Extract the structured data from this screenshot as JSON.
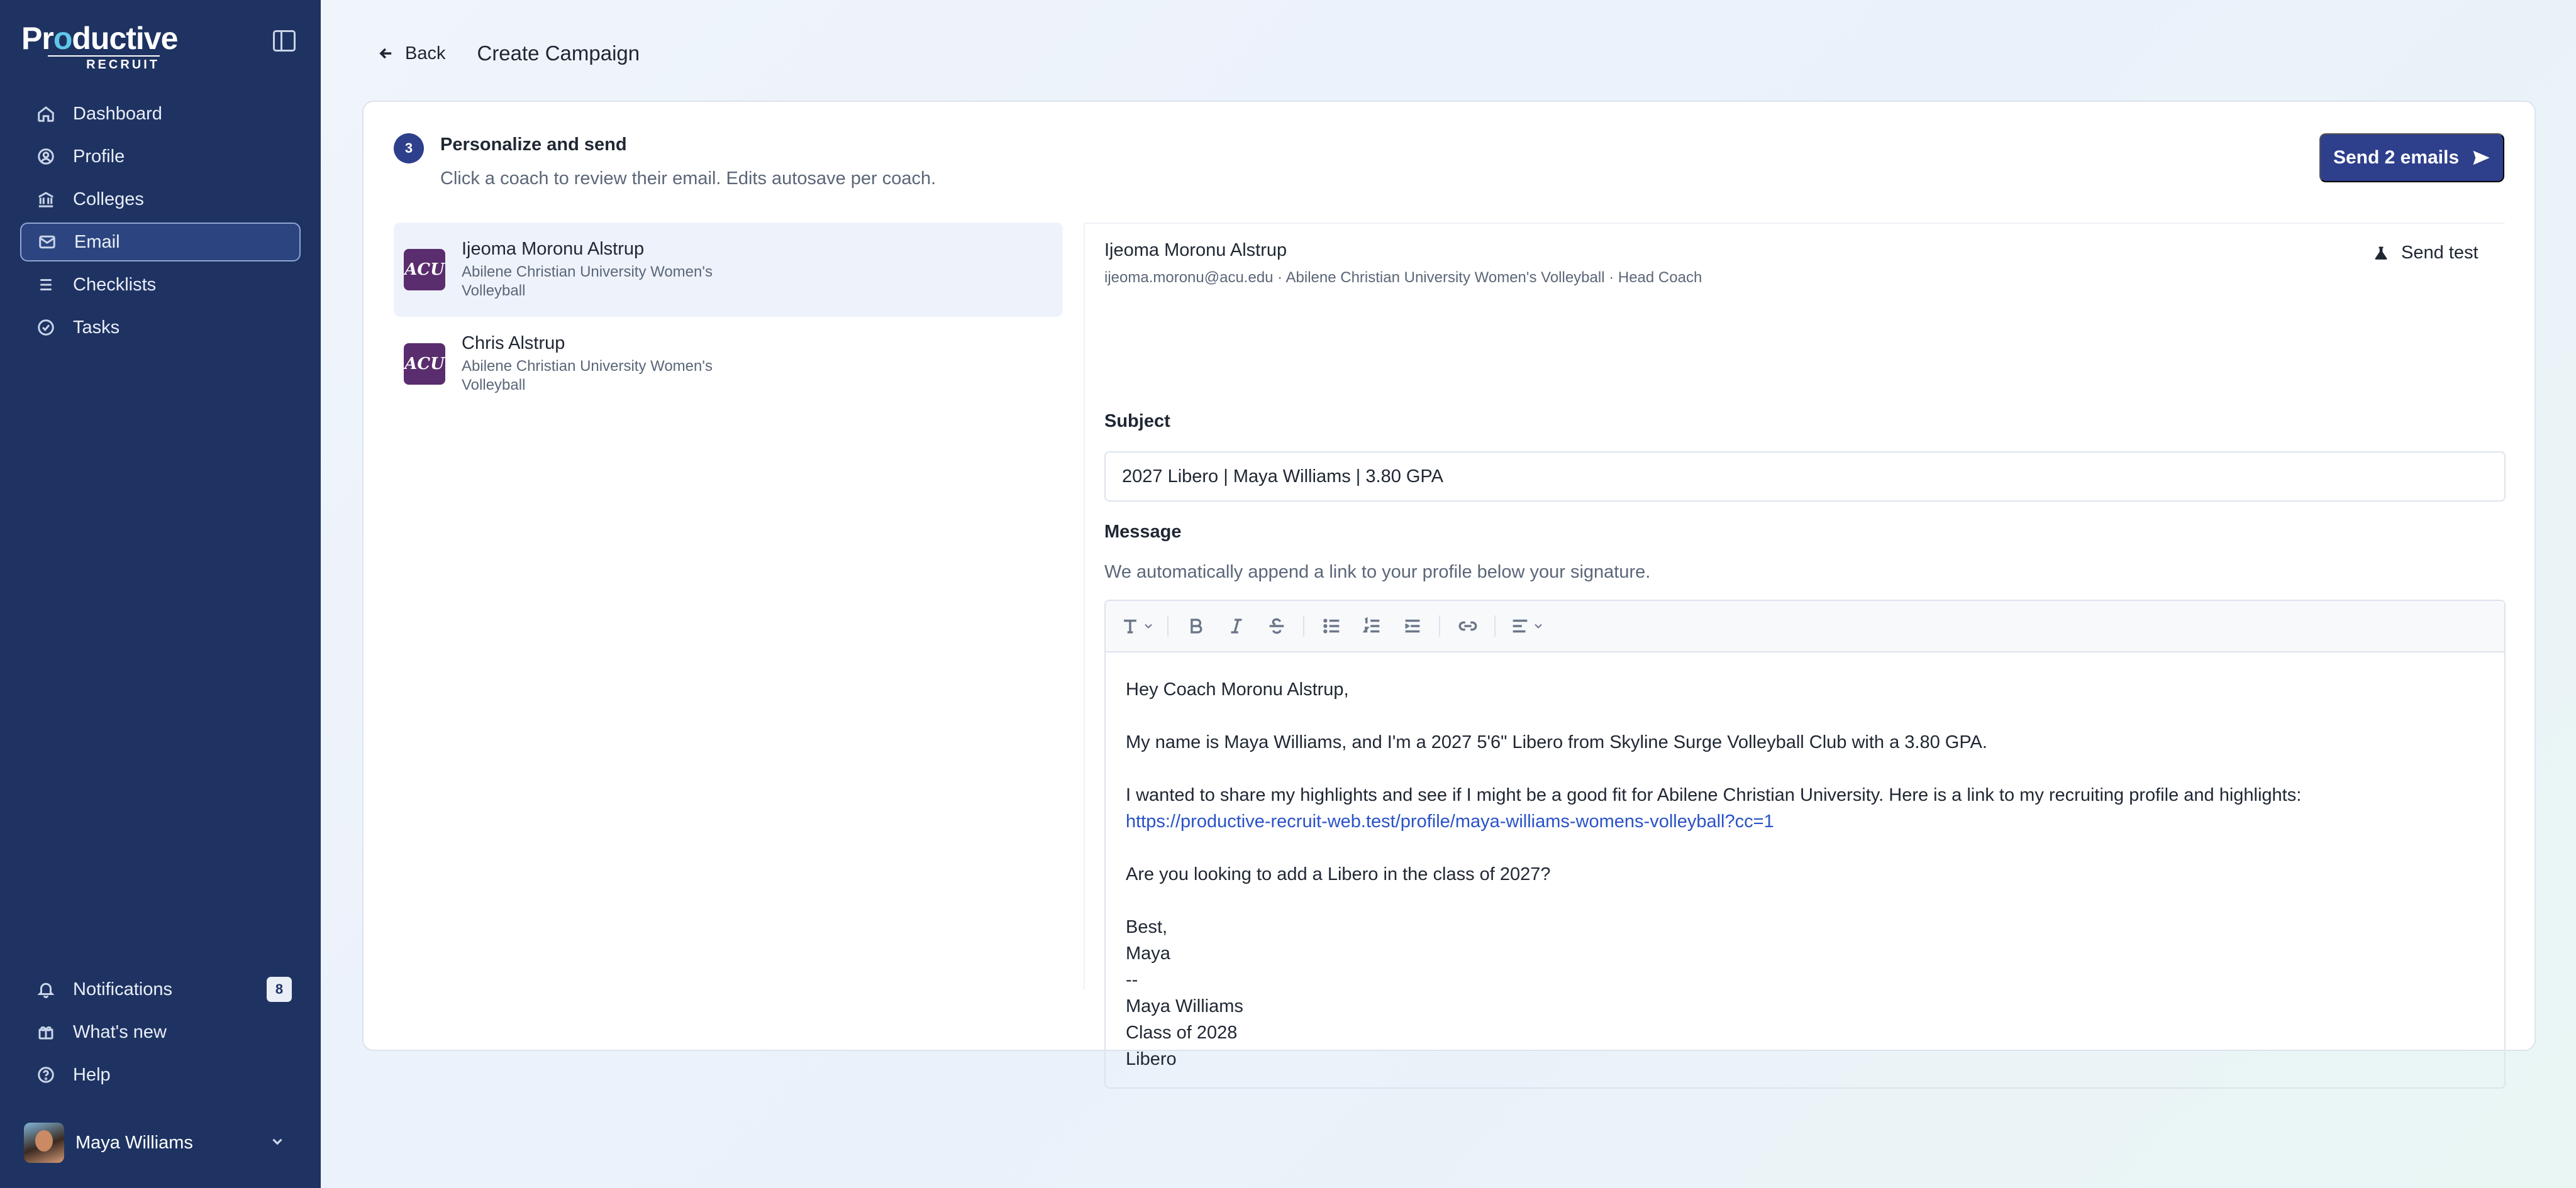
{
  "sidebar": {
    "logo_main": "Productive",
    "logo_sub": "RECRUIT",
    "nav": [
      {
        "label": "Dashboard",
        "icon": "home-icon"
      },
      {
        "label": "Profile",
        "icon": "user-circle-icon"
      },
      {
        "label": "Colleges",
        "icon": "building-icon"
      },
      {
        "label": "Email",
        "icon": "mail-icon",
        "active": true
      },
      {
        "label": "Checklists",
        "icon": "list-icon"
      },
      {
        "label": "Tasks",
        "icon": "check-circle-icon"
      }
    ],
    "bottom": {
      "notifications": "Notifications",
      "notifications_count": "8",
      "whats_new": "What's new",
      "help": "Help"
    },
    "user_name": "Maya Williams"
  },
  "header": {
    "back_label": "Back",
    "title": "Create Campaign"
  },
  "step": {
    "number": "3",
    "title": "Personalize and send",
    "subtitle": "Click a coach to review their email. Edits autosave per coach.",
    "send_label": "Send 2 emails"
  },
  "coaches": [
    {
      "name": "Ijeoma Moronu Alstrup",
      "school": "Abilene Christian University Women's Volleyball",
      "logo_text": "ACU"
    },
    {
      "name": "Chris Alstrup",
      "school": "Abilene Christian University Women's Volleyball",
      "logo_text": "ACU"
    }
  ],
  "email": {
    "recipient_name": "Ijeoma Moronu Alstrup",
    "recipient_meta": "ijeoma.moronu@acu.edu · Abilene Christian University Women's Volleyball · Head Coach",
    "send_test_label": "Send test",
    "subject_label": "Subject",
    "subject_value": "2027 Libero | Maya Williams | 3.80 GPA",
    "message_label": "Message",
    "message_hint": "We automatically append a link to your profile below your signature.",
    "body": {
      "greeting": "Hey Coach Moronu Alstrup,",
      "intro": "My name is Maya Williams, and I'm a 2027 5'6\" Libero from Skyline Surge Volleyball Club with a 3.80 GPA.",
      "share": "I wanted to share my highlights and see if I might be a good fit for Abilene Christian University. Here is a link to my recruiting profile and highlights:",
      "link": "https://productive-recruit-web.test/profile/maya-williams-womens-volleyball?cc=1",
      "question": "Are you looking to add a Libero in the class of 2027?",
      "signoff": "Best,",
      "first_name": "Maya",
      "dashes": "--",
      "sig_name": "Maya Williams",
      "sig_class": "Class of 2028",
      "sig_position": "Libero"
    }
  }
}
